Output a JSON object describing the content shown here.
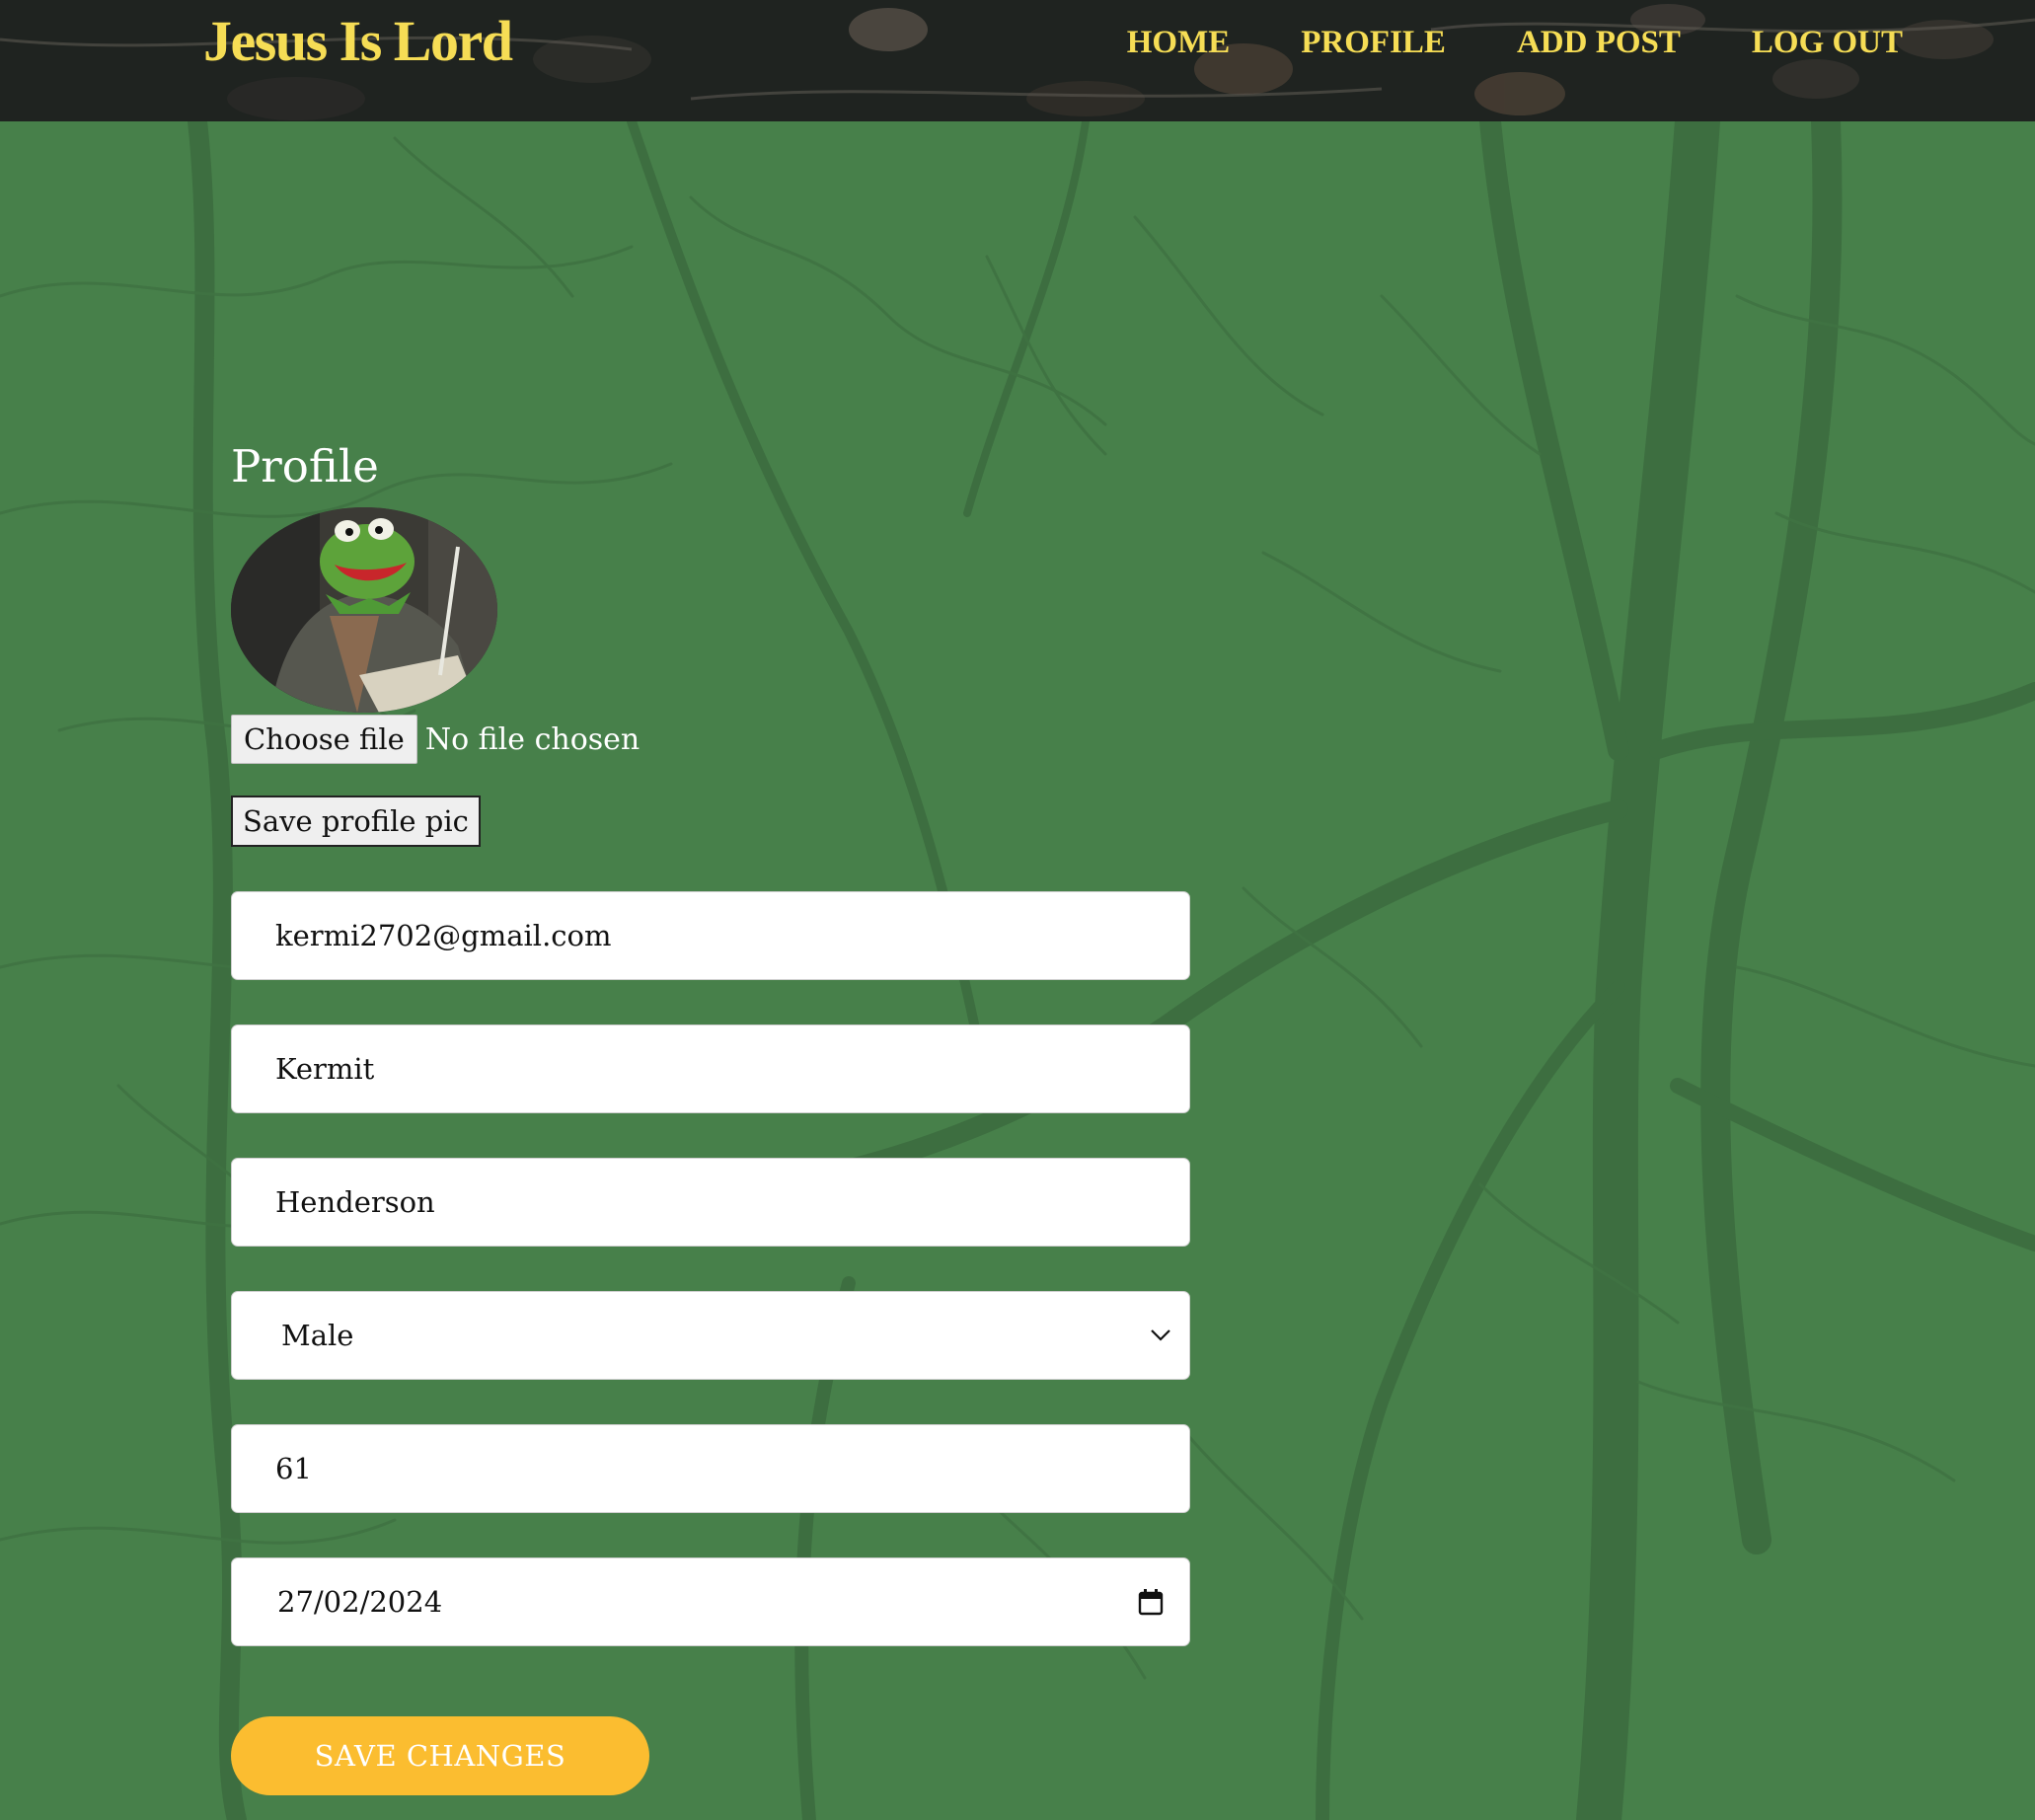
{
  "header": {
    "logo": "Jesus Is Lord",
    "nav": [
      "HOME",
      "PROFILE",
      "ADD POST",
      "LOG OUT"
    ]
  },
  "profile": {
    "title": "Profile",
    "avatar_icon": "kermit-avatar-photo",
    "choose_file_label": "Choose file",
    "file_status": "No file chosen",
    "save_pic_label": "Save profile pic",
    "email": "kermi2702@gmail.com",
    "first_name": "Kermit",
    "last_name": "Henderson",
    "gender": "Male",
    "age": "61",
    "date": "27/02/2024",
    "save_changes_label": "SAVE CHANGES"
  },
  "colors": {
    "background": "#47804a",
    "header_bg": "#1f2320",
    "accent_yellow": "#f6dd55",
    "button_yellow": "#fbbd30"
  }
}
